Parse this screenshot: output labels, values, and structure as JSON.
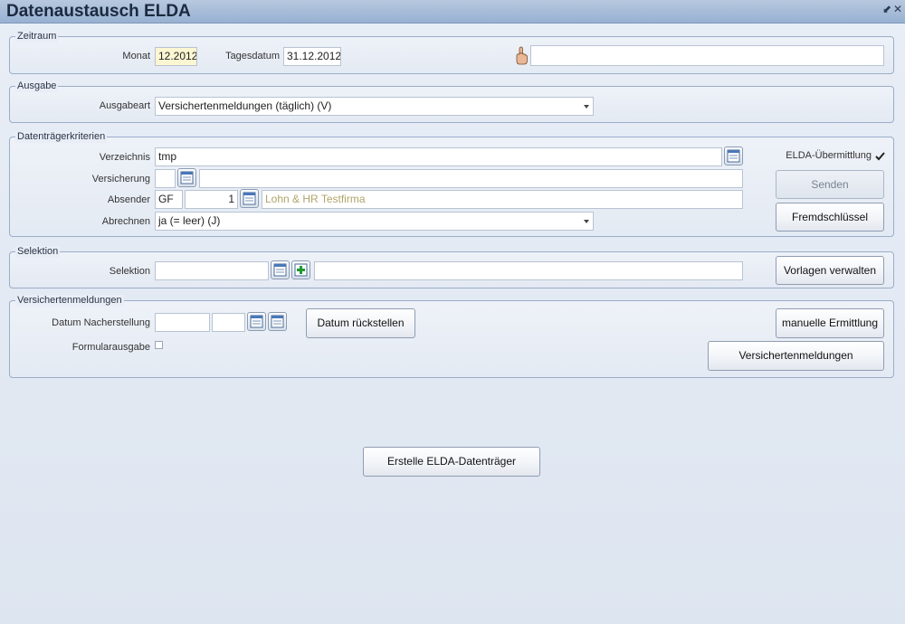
{
  "window": {
    "title": "Datenaustausch ELDA",
    "pin_glyph": "⬋",
    "close_glyph": "✕"
  },
  "zeitraum": {
    "legend": "Zeitraum",
    "monat_label": "Monat",
    "monat_value": "12.2012",
    "tagesdatum_label": "Tagesdatum",
    "tagesdatum_value": "31.12.2012",
    "pointer_icon": "hand-pointer-icon",
    "info_value": ""
  },
  "ausgabe": {
    "legend": "Ausgabe",
    "ausgabeart_label": "Ausgabeart",
    "ausgabeart_value": "Versichertenmeldungen (täglich) (V)"
  },
  "datentraeger": {
    "legend": "Datenträgerkriterien",
    "verzeichnis_label": "Verzeichnis",
    "verzeichnis_value": "tmp",
    "versicherung_label": "Versicherung",
    "versicherung_code": "",
    "versicherung_name": "",
    "absender_label": "Absender",
    "absender_code": "GF",
    "absender_nr": "1",
    "absender_name": "Lohn & HR Testfirma",
    "abrechnen_label": "Abrechnen",
    "abrechnen_value": "ja (= leer) (J)",
    "elda_label": "ELDA-Übermittlung",
    "elda_checked": true,
    "senden_label": "Senden",
    "fremdschluessel_label": "Fremdschlüssel"
  },
  "selektion": {
    "legend": "Selektion",
    "selektion_label": "Selektion",
    "selektion_code": "",
    "selektion_name": "",
    "vorlagen_label": "Vorlagen verwalten"
  },
  "versichertenmeldungen": {
    "legend": "Versichertenmeldungen",
    "datum_label": "Datum Nacherstellung",
    "datum_value_1": "",
    "datum_value_2": "",
    "datum_rueckstellen_label": "Datum rückstellen",
    "formularausgabe_label": "Formularausgabe",
    "formularausgabe_checked": false,
    "manuelle_label": "manuelle Ermittlung",
    "versichertenmeldungen_label": "Versichertenmeldungen"
  },
  "footer": {
    "erstelle_label": "Erstelle ELDA-Datenträger"
  },
  "colors": {
    "accent": "#98b1d2",
    "muted_text": "#b0a46a",
    "field_highlight": "#fcf6d2"
  }
}
